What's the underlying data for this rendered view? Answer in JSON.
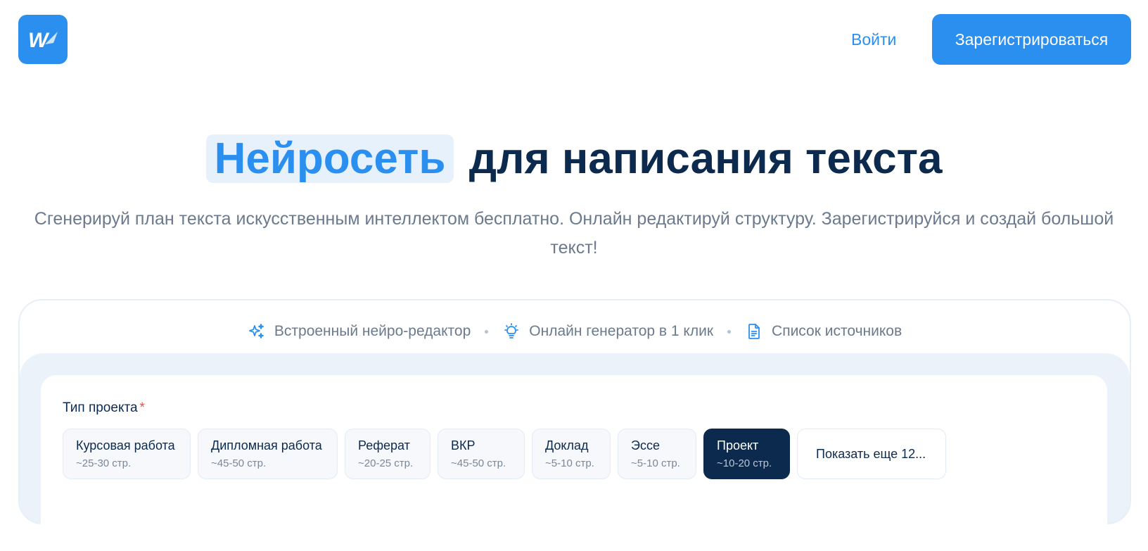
{
  "header": {
    "logo_letter": "W",
    "login_label": "Войти",
    "register_label": "Зарегистрироваться"
  },
  "hero": {
    "title_highlight": "Нейросеть",
    "title_rest": "для написания текста",
    "subtitle": "Сгенерируй план текста искусственным интеллектом бесплатно. Онлайн редактируй структуру. Зарегистрируйся и создай большой текст!"
  },
  "features": [
    {
      "icon": "sparkles-icon",
      "label": "Встроенный нейро-редактор"
    },
    {
      "icon": "lightbulb-icon",
      "label": "Онлайн генератор в 1 клик"
    },
    {
      "icon": "document-icon",
      "label": "Список источников"
    }
  ],
  "form": {
    "project_type_label": "Тип проекта",
    "required_mark": "*",
    "project_types": [
      {
        "title": "Курсовая работа",
        "pages": "~25-30 стр.",
        "selected": false
      },
      {
        "title": "Дипломная работа",
        "pages": "~45-50 стр.",
        "selected": false
      },
      {
        "title": "Реферат",
        "pages": "~20-25 стр.",
        "selected": false
      },
      {
        "title": "ВКР",
        "pages": "~45-50 стр.",
        "selected": false
      },
      {
        "title": "Доклад",
        "pages": "~5-10 стр.",
        "selected": false
      },
      {
        "title": "Эссе",
        "pages": "~5-10 стр.",
        "selected": false
      },
      {
        "title": "Проект",
        "pages": "~10-20 стр.",
        "selected": true
      }
    ],
    "show_more_label": "Показать еще 12..."
  },
  "colors": {
    "accent": "#2b8ff0",
    "dark": "#0c2a4d",
    "muted": "#6b7a8c"
  }
}
